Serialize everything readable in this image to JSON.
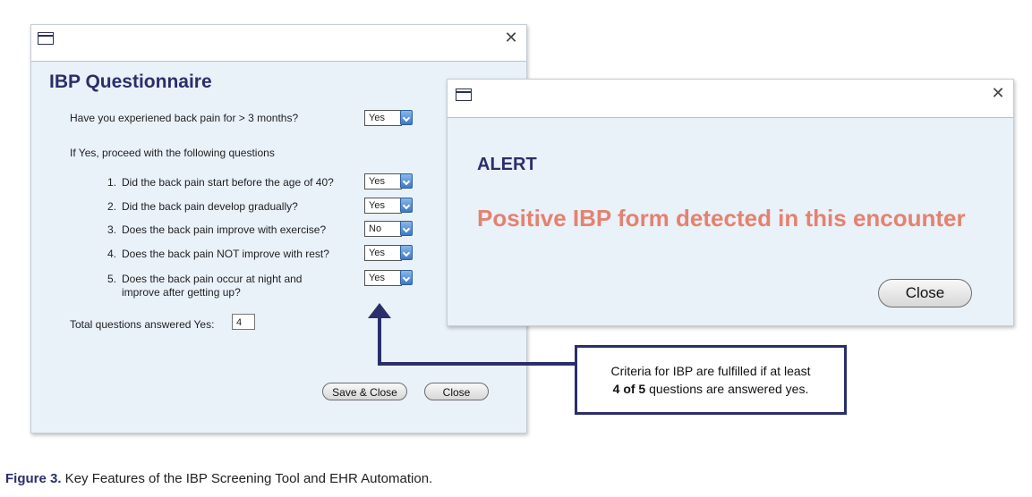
{
  "questionnaire": {
    "title": "IBP Questionnaire",
    "main_question": "Have you experiened back pain for > 3 months?",
    "main_answer": "Yes",
    "instruction": "If Yes, proceed with the following questions",
    "questions": [
      {
        "num": "1.",
        "text": "Did the back pain start before the age of 40?",
        "answer": "Yes"
      },
      {
        "num": "2.",
        "text": "Did the back pain develop gradually?",
        "answer": "Yes"
      },
      {
        "num": "3.",
        "text": "Does the back pain improve with exercise?",
        "answer": "No"
      },
      {
        "num": "4.",
        "text": "Does the back pain NOT improve with rest?",
        "answer": "Yes"
      },
      {
        "num": "5.",
        "text": "Does the back pain occur at night and",
        "text2": "improve after getting up?",
        "answer": "Yes"
      }
    ],
    "total_label": "Total questions answered Yes:",
    "total_value": "4",
    "save_close_label": "Save & Close",
    "close_label": "Close",
    "close_glyph": "✕"
  },
  "alert": {
    "title": "ALERT",
    "message": "Positive IBP form detected in this encounter",
    "close_label": "Close",
    "close_glyph": "✕"
  },
  "callout": {
    "line1": "Criteria for IBP are fulfilled if at least",
    "line2_bold": "4 of 5",
    "line2_rest": " questions are answered yes."
  },
  "caption": {
    "label": "Figure 3.",
    "text": " Key Features of the IBP Screening Tool and EHR Automation."
  },
  "colors": {
    "navy": "#2a2f6b",
    "alert_text": "#e4826f",
    "window_bg": "#e9f1f9"
  }
}
